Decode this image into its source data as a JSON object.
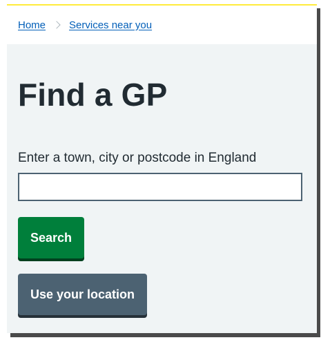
{
  "breadcrumb": {
    "items": [
      {
        "label": "Home"
      },
      {
        "label": "Services near you"
      }
    ]
  },
  "page": {
    "title": "Find a GP"
  },
  "search": {
    "label": "Enter a town, city or postcode in England",
    "value": "",
    "placeholder": "",
    "search_button_label": "Search",
    "location_button_label": "Use your location"
  },
  "colors": {
    "accent_yellow": "#ffeb3b",
    "link_blue": "#005eb8",
    "button_green": "#007f3b",
    "button_grey": "#4c6272",
    "page_background": "#f0f4f5",
    "text_dark": "#212b32"
  },
  "icons": {
    "breadcrumb_separator": "chevron-right-icon"
  }
}
